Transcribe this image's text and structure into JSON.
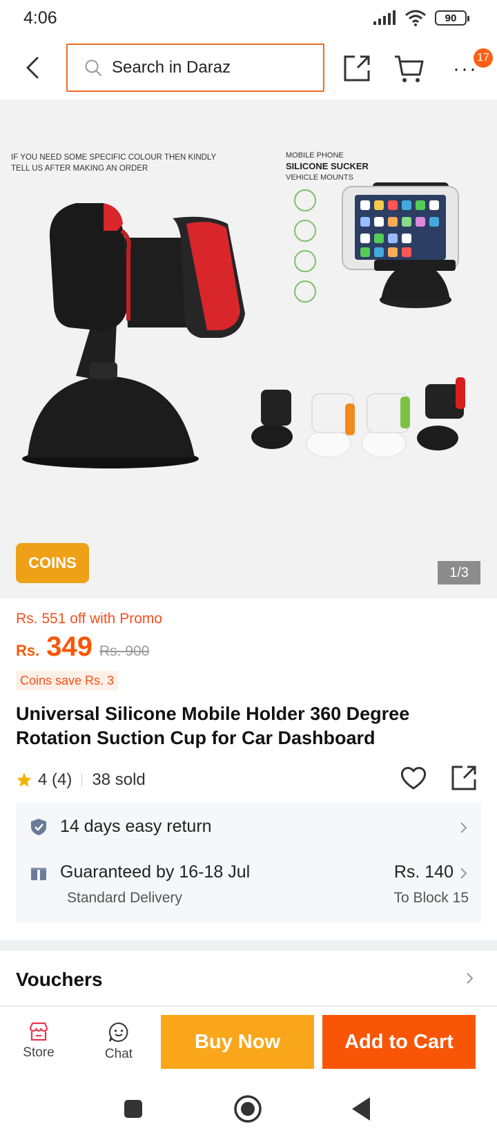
{
  "status_bar": {
    "time": "4:06",
    "battery": "90"
  },
  "top_nav": {
    "search_placeholder": "Search in Daraz",
    "cart_badge": "17",
    "icons": [
      "back-icon",
      "search-icon",
      "share-icon",
      "cart-icon",
      "more-icon"
    ]
  },
  "gallery": {
    "note": "IF YOU NEED SOME SPECIFIC COLOUR THEN KINDLY TELL US AFTER MAKING AN ORDER",
    "image_title_line1": "MOBILE PHONE",
    "image_title_line2": "SILICONE SUCKER",
    "image_title_line3": "VEHICLE MOUNTS",
    "coins_tag": "COINS",
    "page_indicator": "1/3",
    "variant_colors": [
      "#222222",
      "#f28a1b",
      "#7cc243",
      "#d81e1e"
    ]
  },
  "price": {
    "promo": "Rs. 551 off with Promo",
    "currency": "Rs.",
    "current": "349",
    "original": "Rs. 900",
    "coins_save": "Coins save Rs. 3"
  },
  "product": {
    "title": "Universal Silicone Mobile Holder 360 Degree Rotation Suction Cup for Car Dashboard",
    "rating": "4 (4)",
    "sold": "38 sold"
  },
  "services": {
    "return": "14 days easy return",
    "delivery": "Guaranteed by 16-18 Jul",
    "delivery_type": "Standard Delivery",
    "delivery_fee": "Rs. 140",
    "delivery_location": "To Block 15"
  },
  "vouchers": {
    "title": "Vouchers"
  },
  "action_bar": {
    "store": "Store",
    "chat": "Chat",
    "buy_now": "Buy Now",
    "add_to_cart": "Add to Cart"
  },
  "colors": {
    "accent": "#f85606",
    "buy_now": "#faa61a",
    "coins": "#eea116"
  }
}
